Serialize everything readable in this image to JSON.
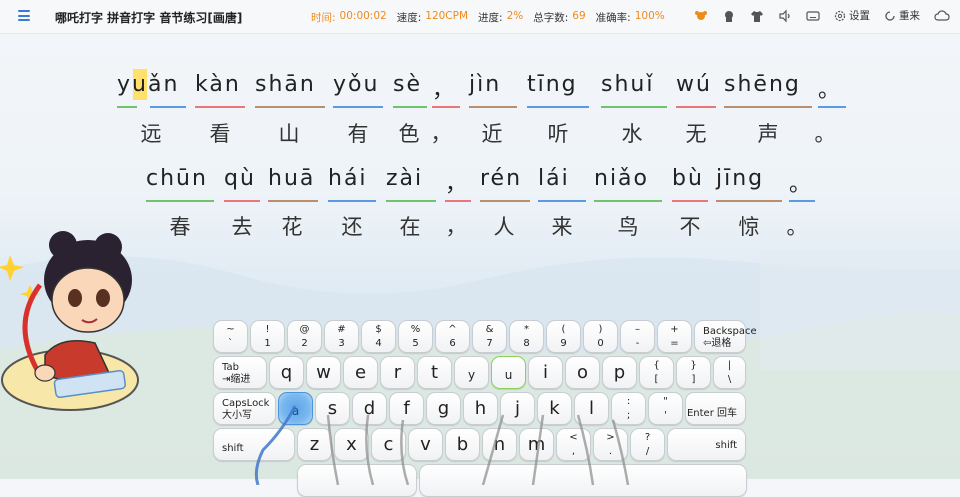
{
  "app": {
    "title": "哪吒打字 拼音打字 音节练习[画唐]"
  },
  "stats": [
    {
      "label": "时间:",
      "value": "00:00:02"
    },
    {
      "label": "速度:",
      "value": "120CPM"
    },
    {
      "label": "进度:",
      "value": "2%"
    },
    {
      "label": "总字数:",
      "value": "69"
    },
    {
      "label": "准确率:",
      "value": "100%"
    }
  ],
  "toolbar": {
    "settings_label": "设置",
    "restart_label": "重来"
  },
  "colors": {
    "accent": "#f08a1c",
    "cursor": "#ffe06a",
    "green": "#6fc36a",
    "red": "#e8777a",
    "blue": "#5b9be4",
    "brown": "#b89070"
  },
  "lines": [
    {
      "pinyin": [
        "yuǎn",
        "kàn",
        "shān",
        "yǒu",
        "sè",
        "，",
        "jìn",
        "tīng",
        "shuǐ",
        "wú",
        "shēng",
        "。"
      ],
      "hanzi": [
        "远",
        "看",
        "山",
        "有",
        "色",
        "，",
        "近",
        "听",
        "水",
        "无",
        "声",
        "。"
      ]
    },
    {
      "pinyin": [
        "chūn",
        "qù",
        "huā",
        "hái",
        "zài",
        "，",
        "rén",
        "lái",
        "niǎo",
        "bù",
        "jīng",
        "。"
      ],
      "hanzi": [
        "春",
        "去",
        "花",
        "还",
        "在",
        "，",
        "人",
        "来",
        "鸟",
        "不",
        "惊",
        "。"
      ]
    }
  ],
  "keyboard": {
    "row1": [
      {
        "top": "~",
        "bot": "`"
      },
      {
        "top": "!",
        "bot": "1"
      },
      {
        "top": "@",
        "bot": "2"
      },
      {
        "top": "#",
        "bot": "3"
      },
      {
        "top": "$",
        "bot": "4"
      },
      {
        "top": "%",
        "bot": "5"
      },
      {
        "top": "^",
        "bot": "6"
      },
      {
        "top": "&",
        "bot": "7"
      },
      {
        "top": "*",
        "bot": "8"
      },
      {
        "top": "(",
        "bot": "9"
      },
      {
        "top": ")",
        "bot": "0"
      },
      {
        "top": "–",
        "bot": "-"
      },
      {
        "top": "+",
        "bot": "="
      }
    ],
    "backspace": {
      "line1": "Backspace",
      "line2": "⇦退格"
    },
    "tab": {
      "line1": "Tab",
      "line2": "⇥缩进"
    },
    "row2": [
      "q",
      "w",
      "e",
      "r",
      "t",
      "y",
      "u",
      "i",
      "o",
      "p"
    ],
    "row2_sym": [
      {
        "top": "{",
        "bot": "["
      },
      {
        "top": "}",
        "bot": "]"
      },
      {
        "top": "|",
        "bot": "\\"
      }
    ],
    "caps": {
      "line1": "CapsLock",
      "line2": "大小写"
    },
    "row3": [
      "a",
      "s",
      "d",
      "f",
      "g",
      "h",
      "j",
      "k",
      "l"
    ],
    "row3_sym": [
      {
        "top": ":",
        "bot": ";"
      },
      {
        "top": "\"",
        "bot": "'"
      }
    ],
    "enter": "Enter 回车",
    "shift_left": "shift",
    "row4": [
      "z",
      "x",
      "c",
      "v",
      "b",
      "n",
      "m"
    ],
    "row4_sym": [
      {
        "top": "<",
        "bot": ","
      },
      {
        "top": ">",
        "bot": "."
      },
      {
        "top": "?",
        "bot": "/"
      }
    ],
    "shift_right": "shift",
    "next_key": "u",
    "hint_key": "a"
  }
}
